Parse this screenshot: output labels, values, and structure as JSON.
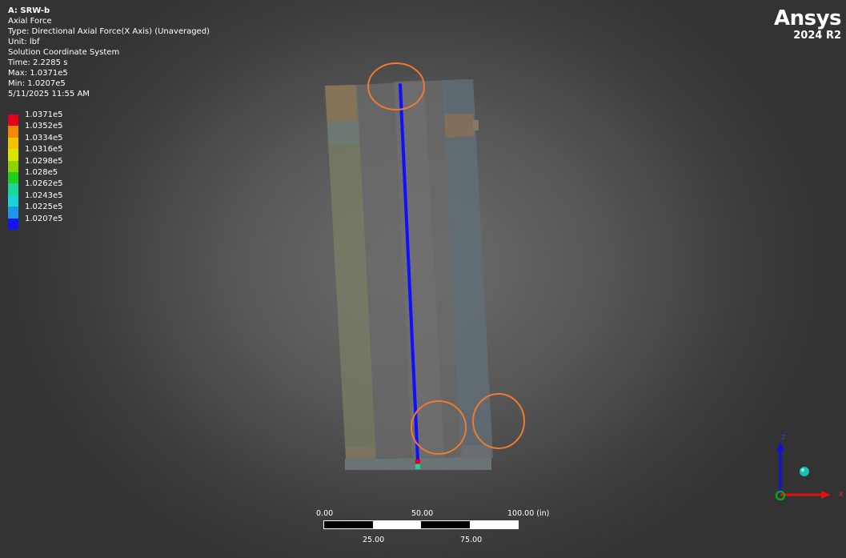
{
  "info": {
    "title": "A: SRW-b",
    "result": "Axial Force",
    "type": "Type: Directional Axial Force(X Axis) (Unaveraged)",
    "unit": "Unit: lbf",
    "coords": "Solution Coordinate System",
    "time": "Time: 2.2285 s",
    "max": "Max: 1.0371e5",
    "min": "Min: 1.0207e5",
    "datetime": "5/11/2025 11:55 AM"
  },
  "legend": [
    {
      "label": "1.0371e5",
      "color": "#e3001b"
    },
    {
      "label": "1.0352e5",
      "color": "#f28a00"
    },
    {
      "label": "1.0334e5",
      "color": "#f1c300"
    },
    {
      "label": "1.0316e5",
      "color": "#dbe600"
    },
    {
      "label": "1.0298e5",
      "color": "#8fd400"
    },
    {
      "label": "1.028e5",
      "color": "#1fd01f"
    },
    {
      "label": "1.0262e5",
      "color": "#1fd69a"
    },
    {
      "label": "1.0243e5",
      "color": "#19d4d8"
    },
    {
      "label": "1.0225e5",
      "color": "#1a9ae4"
    },
    {
      "label": "1.0207e5",
      "color": "#1414f0"
    }
  ],
  "logo": {
    "brand": "Ansys",
    "version": "2024 R2"
  },
  "scale": {
    "top_labels": [
      "0.00",
      "50.00",
      "100.00 (in)"
    ],
    "bottom_labels": [
      "25.00",
      "75.00"
    ]
  },
  "triad": {
    "x": "X",
    "y": "Y",
    "z": "Z"
  },
  "colors": {
    "beam": "#1010ff",
    "annotation": "#f07a30",
    "x_axis": "#e01010",
    "y_axis": "#10a010",
    "z_axis": "#1010e0"
  }
}
